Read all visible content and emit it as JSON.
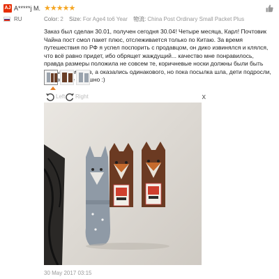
{
  "reviewer": {
    "avatar_text": "AJ",
    "name": "A*****j M.",
    "country": "RU"
  },
  "rating": {
    "stars": 5,
    "star_glyph": "★★★★★",
    "color": "#f5a623"
  },
  "attributes": {
    "color_label": "Color:",
    "color_value": "2",
    "size_label": "Size:",
    "size_value": "For Age4 to6 Year",
    "logistics_label": "物流:",
    "logistics_value": "China Post Ordinary Small Packet Plus"
  },
  "review_text": "Заказ был сделан 30.01, получен сегодня 30.04! Четыре месяца, Карл! Почтовик Чайна пост смол пакет плюс, отслеживается только по Китаю. За время путешествия по РФ я успел поспорить с продавцом, он дико извинялся и клялся, что всё равно придет, ибо обрящет жаждущий... качество мне понравилось, правда размеры положила не совсем те, коричневые носки должны были быть разных размеров, а оказались одинакового, но пока посылка шла, дети подросли, поэтому не страшно :)",
  "viewer": {
    "rotate_left_label": "Left",
    "rotate_right_label": "Right",
    "close_glyph": "x"
  },
  "date": "30 May 2017 03:15",
  "icons": {
    "thumb_up": "thumbs-up-icon",
    "rotate_left": "rotate-left-icon",
    "rotate_right": "rotate-right-icon",
    "close": "close-icon"
  },
  "colors": {
    "avatar_bg": "#e62e04",
    "accent_caret": "#e67e22"
  }
}
